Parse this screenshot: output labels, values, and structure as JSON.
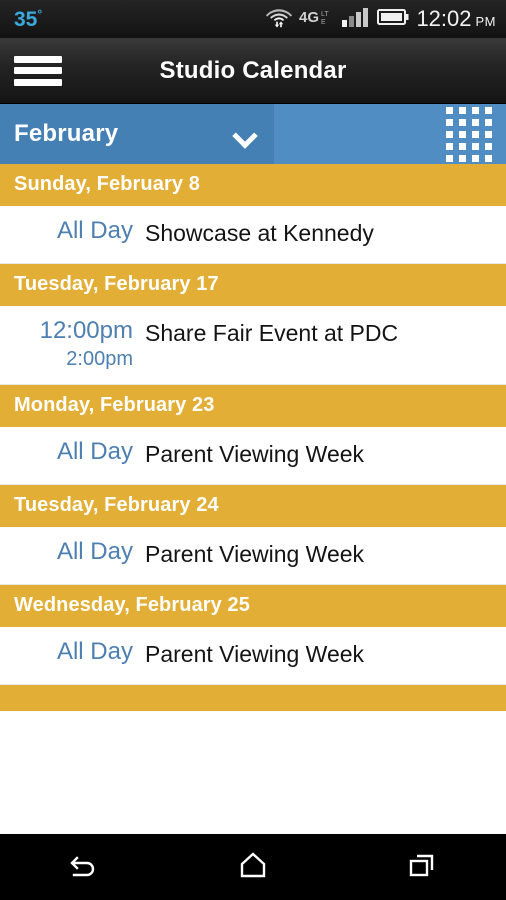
{
  "status_bar": {
    "temperature": "35",
    "degree_symbol": "°",
    "wifi_icon": "wifi-signal-icon",
    "network_label": "4G",
    "network_sub_label": "LTE",
    "cell_signal_icon": "cell-signal-bars-icon",
    "battery_icon": "battery-full-icon",
    "time": "12:02",
    "am_pm": "PM",
    "temp_color": "#3aa8dd",
    "text_color": "#f2f2f2",
    "background": "#1c1c1c"
  },
  "title_bar": {
    "menu_icon": "hamburger-menu-icon",
    "title": "Studio Calendar",
    "background": "#232323"
  },
  "month_bar": {
    "month": "February",
    "dropdown_icon": "chevron-down-icon",
    "grid_view_icon": "grid-view-icon",
    "grid_columns": 4,
    "grid_rows": 5,
    "select_background": "#4480b4",
    "bar_background": "#4f8dc2"
  },
  "agenda": {
    "header_background": "#e3ae35",
    "header_text_color": "#ffffff",
    "time_text_color": "#4d7fb0",
    "title_text_color": "#141414",
    "days": [
      {
        "date_label": "Sunday, February 8",
        "events": [
          {
            "time_start": "All Day",
            "time_end": "",
            "title": "Showcase at Kennedy"
          }
        ]
      },
      {
        "date_label": "Tuesday, February 17",
        "events": [
          {
            "time_start": "12:00pm",
            "time_end": "2:00pm",
            "title": "Share Fair Event at PDC"
          }
        ]
      },
      {
        "date_label": "Monday, February 23",
        "events": [
          {
            "time_start": "All Day",
            "time_end": "",
            "title": "Parent Viewing Week"
          }
        ]
      },
      {
        "date_label": "Tuesday, February 24",
        "events": [
          {
            "time_start": "All Day",
            "time_end": "",
            "title": "Parent Viewing Week"
          }
        ]
      },
      {
        "date_label": "Wednesday, February 25",
        "events": [
          {
            "time_start": "All Day",
            "time_end": "",
            "title": "Parent Viewing Week"
          }
        ]
      }
    ],
    "partial_next_day_label": ""
  },
  "nav_bar": {
    "back_icon": "back-arrow-icon",
    "home_icon": "home-icon",
    "recents_icon": "recent-apps-icon",
    "background": "#000000"
  }
}
